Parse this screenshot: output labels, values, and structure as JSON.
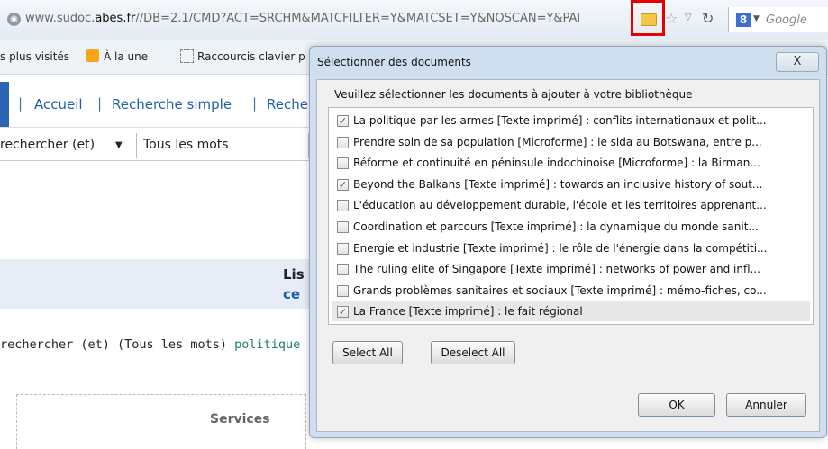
{
  "browser": {
    "url_prefix": "www.sudoc.",
    "url_domain": "abes.fr",
    "url_rest": "//DB=2.1/CMD?ACT=SRCHM&MATCFILTER=Y&MATCSET=Y&NOSCAN=Y&PAI",
    "search_engine": "Google",
    "search_logo": "8"
  },
  "bookmarks": [
    "s plus visités",
    "À la une",
    "Raccourcis clavier p"
  ],
  "page": {
    "nav": [
      "Accueil",
      "Recherche simple",
      "Reche"
    ],
    "field_select": "rechercher (et)",
    "field_value": "Tous les mots",
    "band_title": "Lis",
    "band_sub": "ce",
    "query_text": "rechercher (et) (Tous les mots) ",
    "query_link": "politique",
    "services_label": "Services"
  },
  "dialog": {
    "title": "Sélectionner des documents",
    "close_label": "X",
    "prompt": "Veuillez sélectionner les documents à ajouter à votre bibliothèque",
    "items": [
      {
        "label": "La politique par les armes [Texte imprimé] : conflits internationaux et polit...",
        "checked": true
      },
      {
        "label": "Prendre soin de sa population [Microforme] : le sida au Botswana, entre p...",
        "checked": false
      },
      {
        "label": "Réforme et continuité en péninsule indochinoise [Microforme] : la Birman...",
        "checked": false
      },
      {
        "label": "Beyond the Balkans [Texte imprimé] : towards an inclusive history of sout...",
        "checked": true
      },
      {
        "label": "L'éducation au développement durable, l'école et les territoires apprenant...",
        "checked": false
      },
      {
        "label": "Coordination et parcours [Texte imprimé] : la dynamique du monde sanit...",
        "checked": false
      },
      {
        "label": "Energie et industrie [Texte imprimé] : le rôle de l'énergie dans la compétiti...",
        "checked": false
      },
      {
        "label": "The ruling elite of Singapore [Texte imprimé] : networks of power and infl...",
        "checked": false
      },
      {
        "label": "Grands problèmes sanitaires et sociaux [Texte imprimé] : mémo-fiches, co...",
        "checked": false
      },
      {
        "label": "La France [Texte imprimé] : le fait régional",
        "checked": true
      }
    ],
    "select_all": "Select All",
    "deselect_all": "Deselect All",
    "ok": "OK",
    "cancel": "Annuler"
  }
}
